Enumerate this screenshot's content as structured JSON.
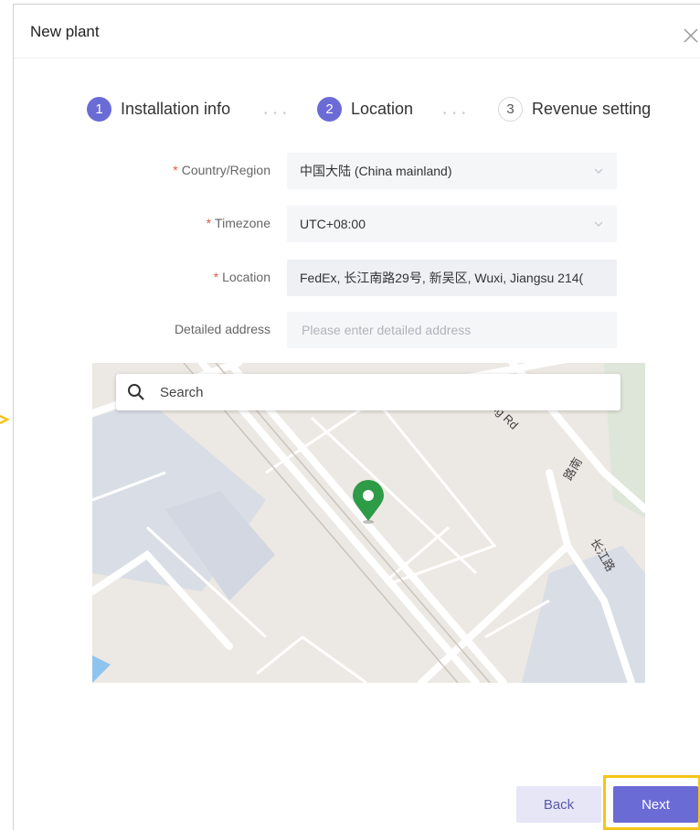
{
  "dialog": {
    "title": "New plant"
  },
  "steps": [
    {
      "number": "1",
      "label": "Installation info",
      "state": "completed"
    },
    {
      "number": "2",
      "label": "Location",
      "state": "current"
    },
    {
      "number": "3",
      "label": "Revenue setting",
      "state": "pending"
    }
  ],
  "form": {
    "country": {
      "label": "Country/Region",
      "value": "中国大陆 (China mainland)",
      "required": true
    },
    "timezone": {
      "label": "Timezone",
      "value": "UTC+08:00",
      "required": true
    },
    "location": {
      "label": "Location",
      "value": "FedEx, 长江南路29号, 新吴区, Wuxi, Jiangsu 214(",
      "required": true
    },
    "detailed_address": {
      "label": "Detailed address",
      "value": "",
      "placeholder": "Please enter detailed address",
      "required": false
    }
  },
  "map": {
    "search_placeholder": "Search",
    "labels": {
      "road_1": "ang Rd",
      "road_2": "路南",
      "road_3": "长江路"
    }
  },
  "footer": {
    "back_label": "Back",
    "next_label": "Next"
  },
  "colors": {
    "accent": "#6b6bd6",
    "highlight": "#f5c518",
    "pin": "#2e9b47",
    "required": "#e2574c"
  }
}
